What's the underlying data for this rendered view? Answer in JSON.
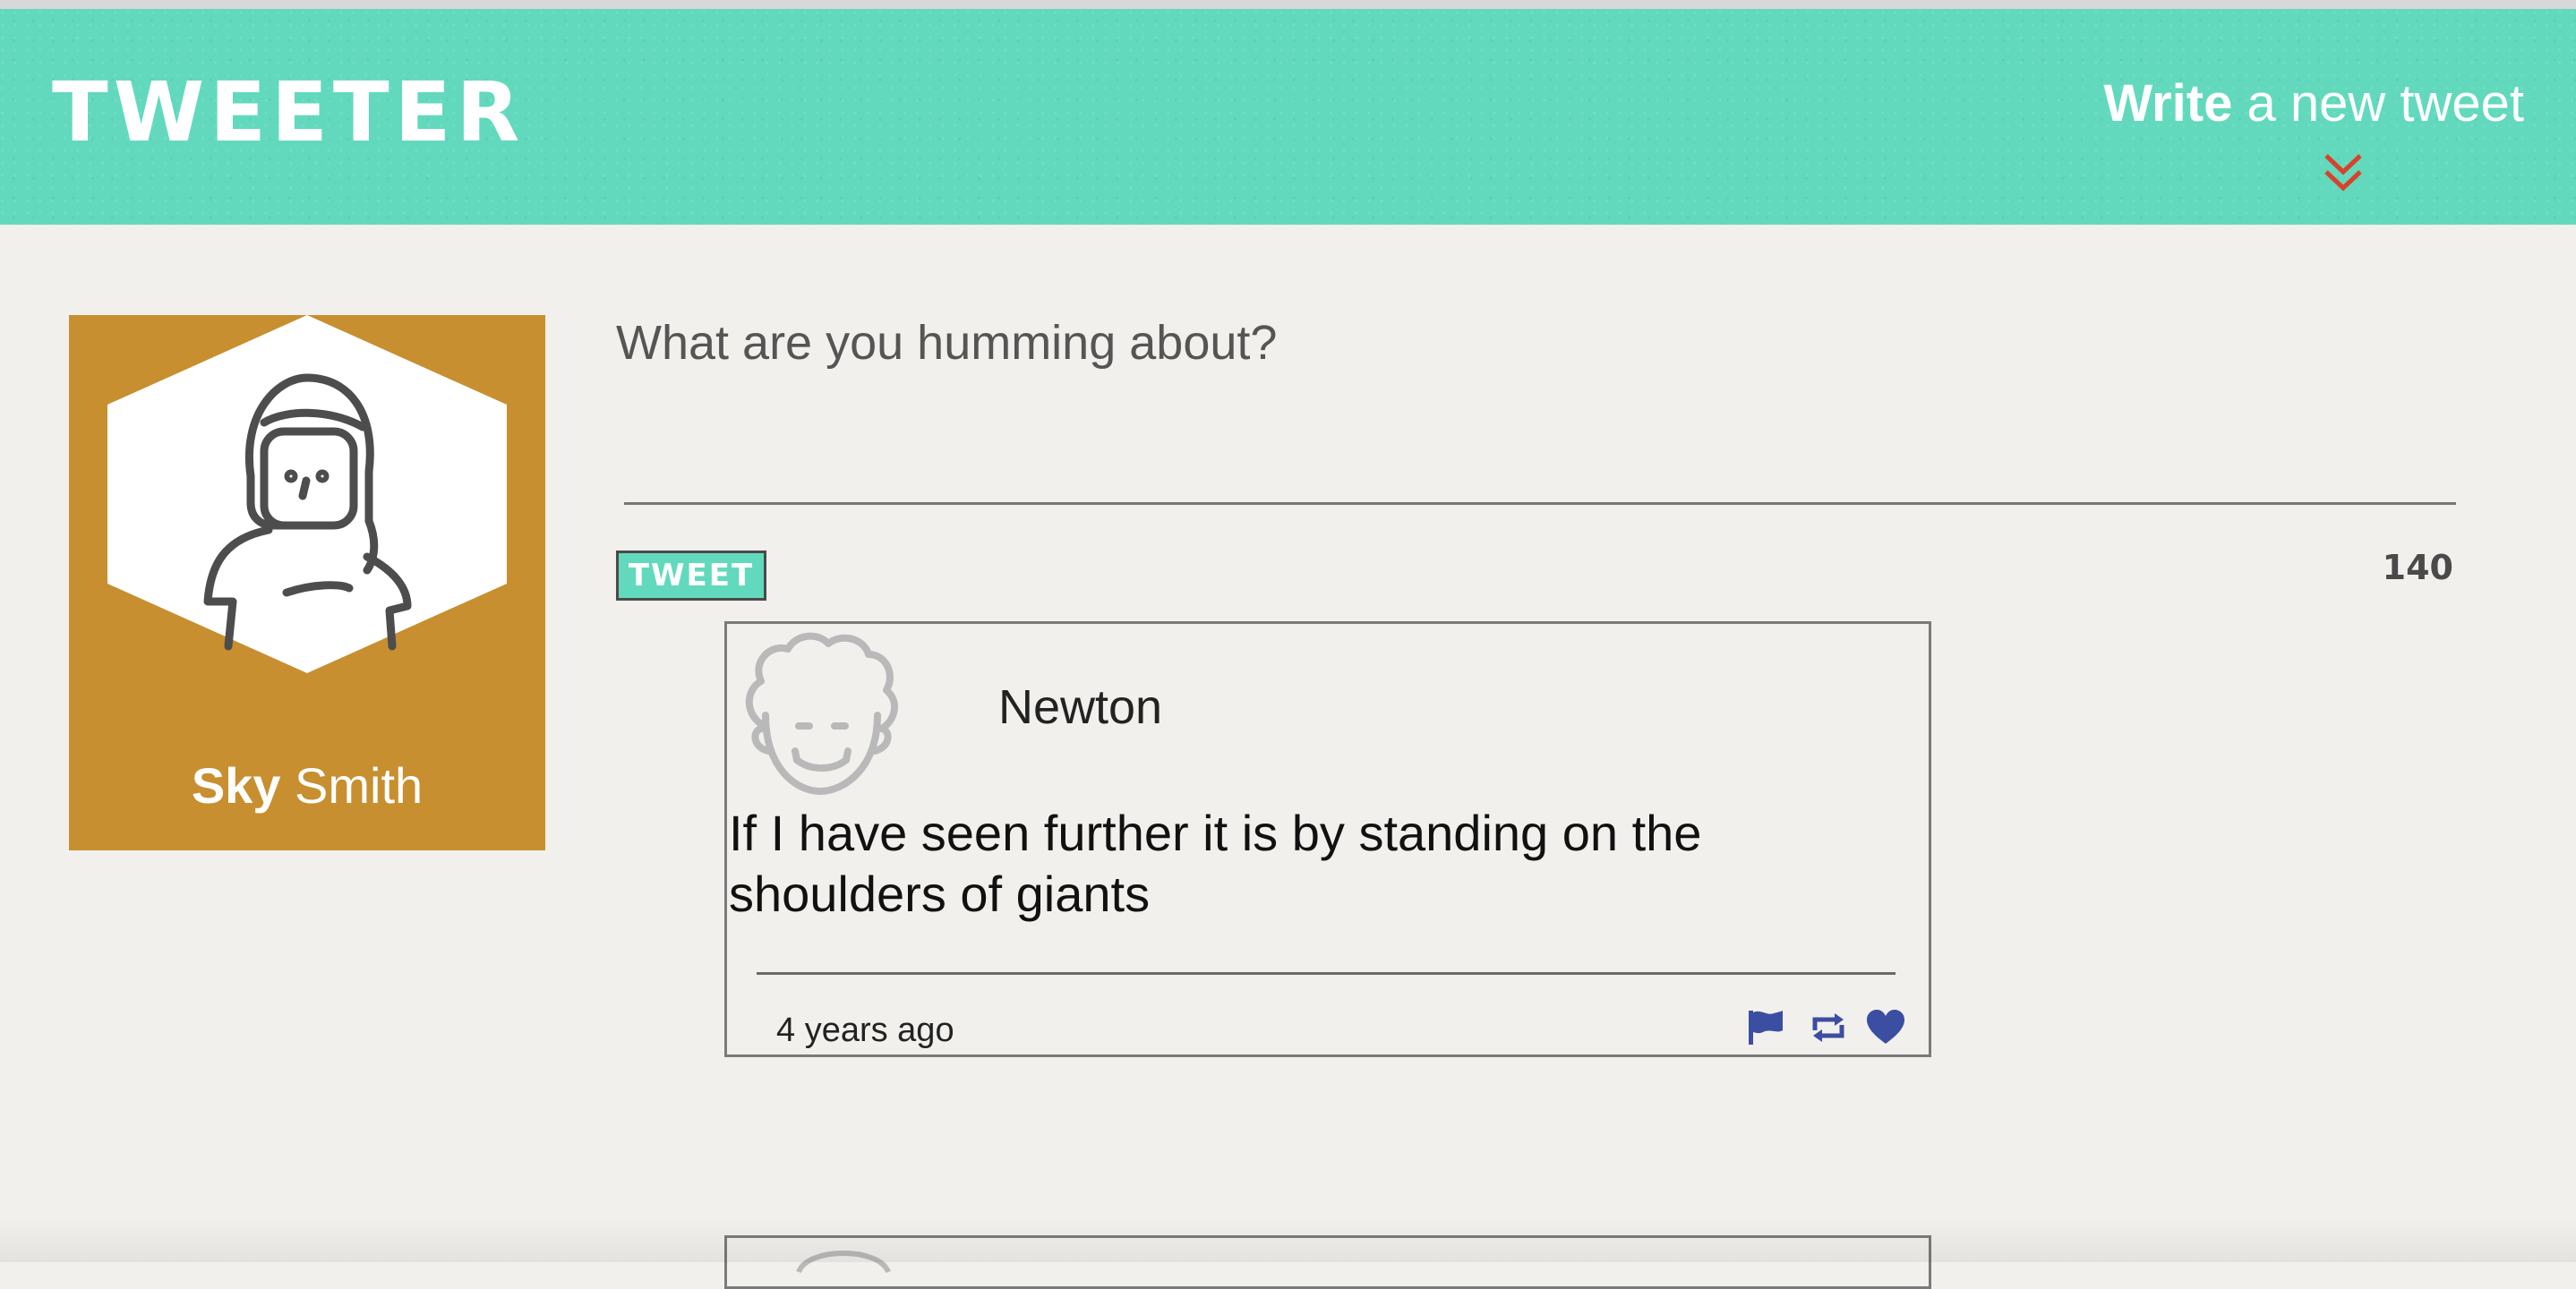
{
  "header": {
    "brand": "TWEETER",
    "write_bold": "Write",
    "write_rest": " a new tweet",
    "accent_color": "#62d9bd",
    "chevron_color": "#d9412b"
  },
  "profile": {
    "first_name": "Sky",
    "last_name": " Smith",
    "card_color": "#c78f2f"
  },
  "composer": {
    "placeholder": "What are you humming about?",
    "tweet_button": "TWEET",
    "char_counter": "140"
  },
  "tweets": [
    {
      "author": "Newton",
      "content": "If I have seen further it is by standing on the shoulders of giants",
      "time": "4 years ago",
      "icon_color": "#3b4ea1"
    }
  ]
}
